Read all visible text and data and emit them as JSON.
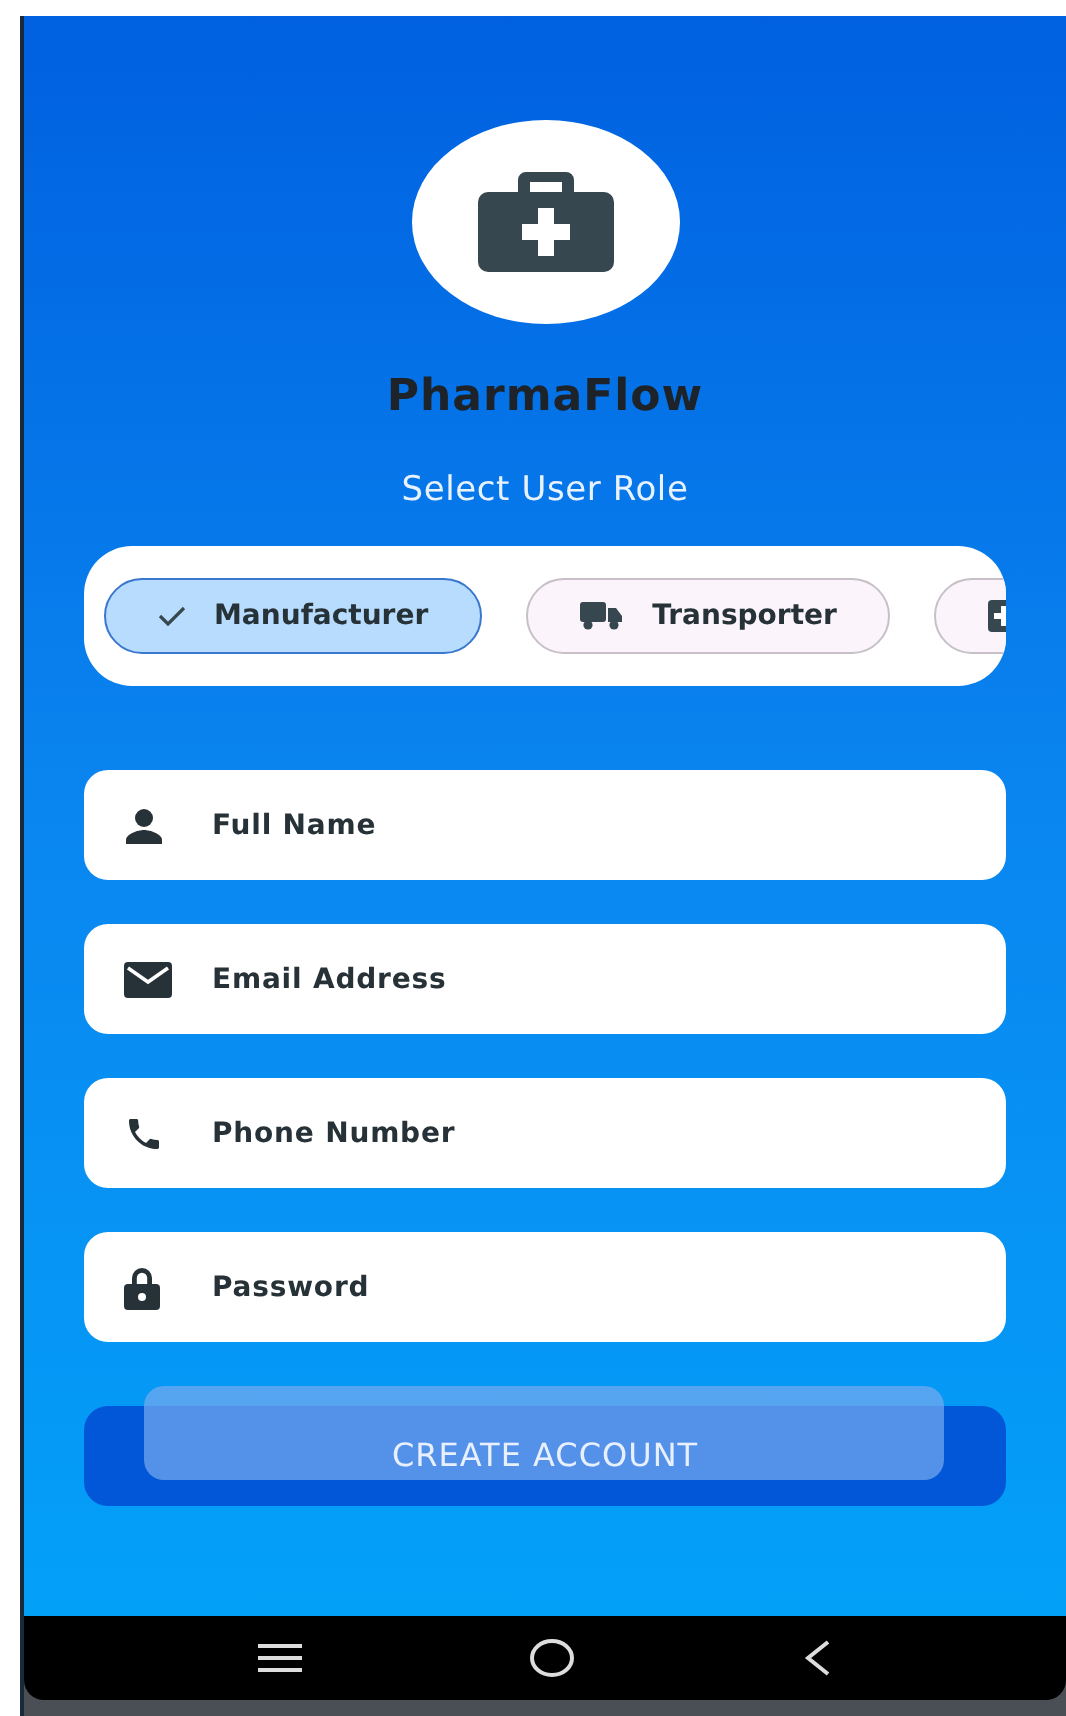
{
  "app": {
    "title": "PharmaFlow",
    "subtitle": "Select User Role"
  },
  "roles": [
    {
      "label": "Manufacturer",
      "selected": true
    },
    {
      "label": "Transporter",
      "kind": "transport",
      "selected": false
    },
    {
      "kind": "medical",
      "selected": false
    }
  ],
  "fields": [
    {
      "kind": "name",
      "placeholder": "Full Name"
    },
    {
      "kind": "email",
      "placeholder": "Email Address"
    },
    {
      "kind": "phone",
      "placeholder": "Phone Number"
    },
    {
      "kind": "password",
      "placeholder": "Password"
    }
  ],
  "button": {
    "label": "CREATE ACCOUNT"
  }
}
